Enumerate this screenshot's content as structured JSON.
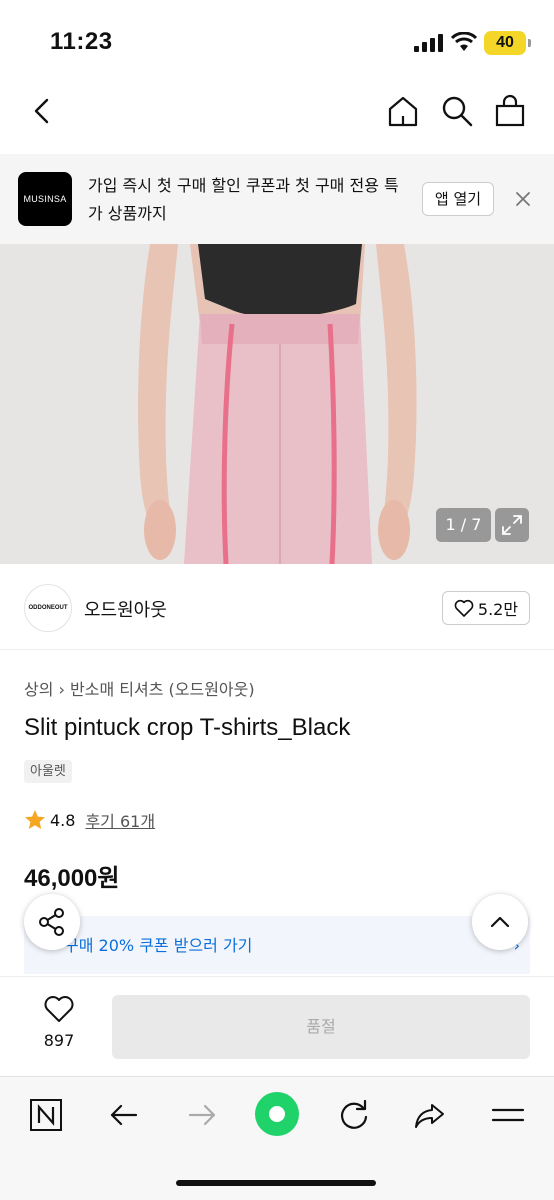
{
  "status_bar": {
    "time": "11:23",
    "battery": "40"
  },
  "banner": {
    "logo_text": "MUSINSA",
    "message": "가입 즉시 첫 구매 할인 쿠폰과 첫 구매 전용 특가 상품까지",
    "open_app": "앱 열기"
  },
  "gallery": {
    "counter": "1 / 7"
  },
  "brand": {
    "logo_text": "ODDONEOUT",
    "name": "오드원아웃",
    "likes": "5.2만"
  },
  "product": {
    "breadcrumb_category": "상의",
    "breadcrumb_sub": "반소매 티셔츠 (오드원아웃)",
    "title": "Slit pintuck crop T-shirts_Black",
    "tag": "아울렛",
    "rating": "4.8",
    "reviews": "후기 61개",
    "price": "46,000원",
    "coupon": "구매 20% 쿠폰 받으러 가기"
  },
  "buy_bar": {
    "wish_count": "897",
    "soldout_label": "품절"
  },
  "colors": {
    "accent_blue": "#0a6fdd",
    "star": "#f5a623",
    "toolbar_green": "#20d26a"
  }
}
